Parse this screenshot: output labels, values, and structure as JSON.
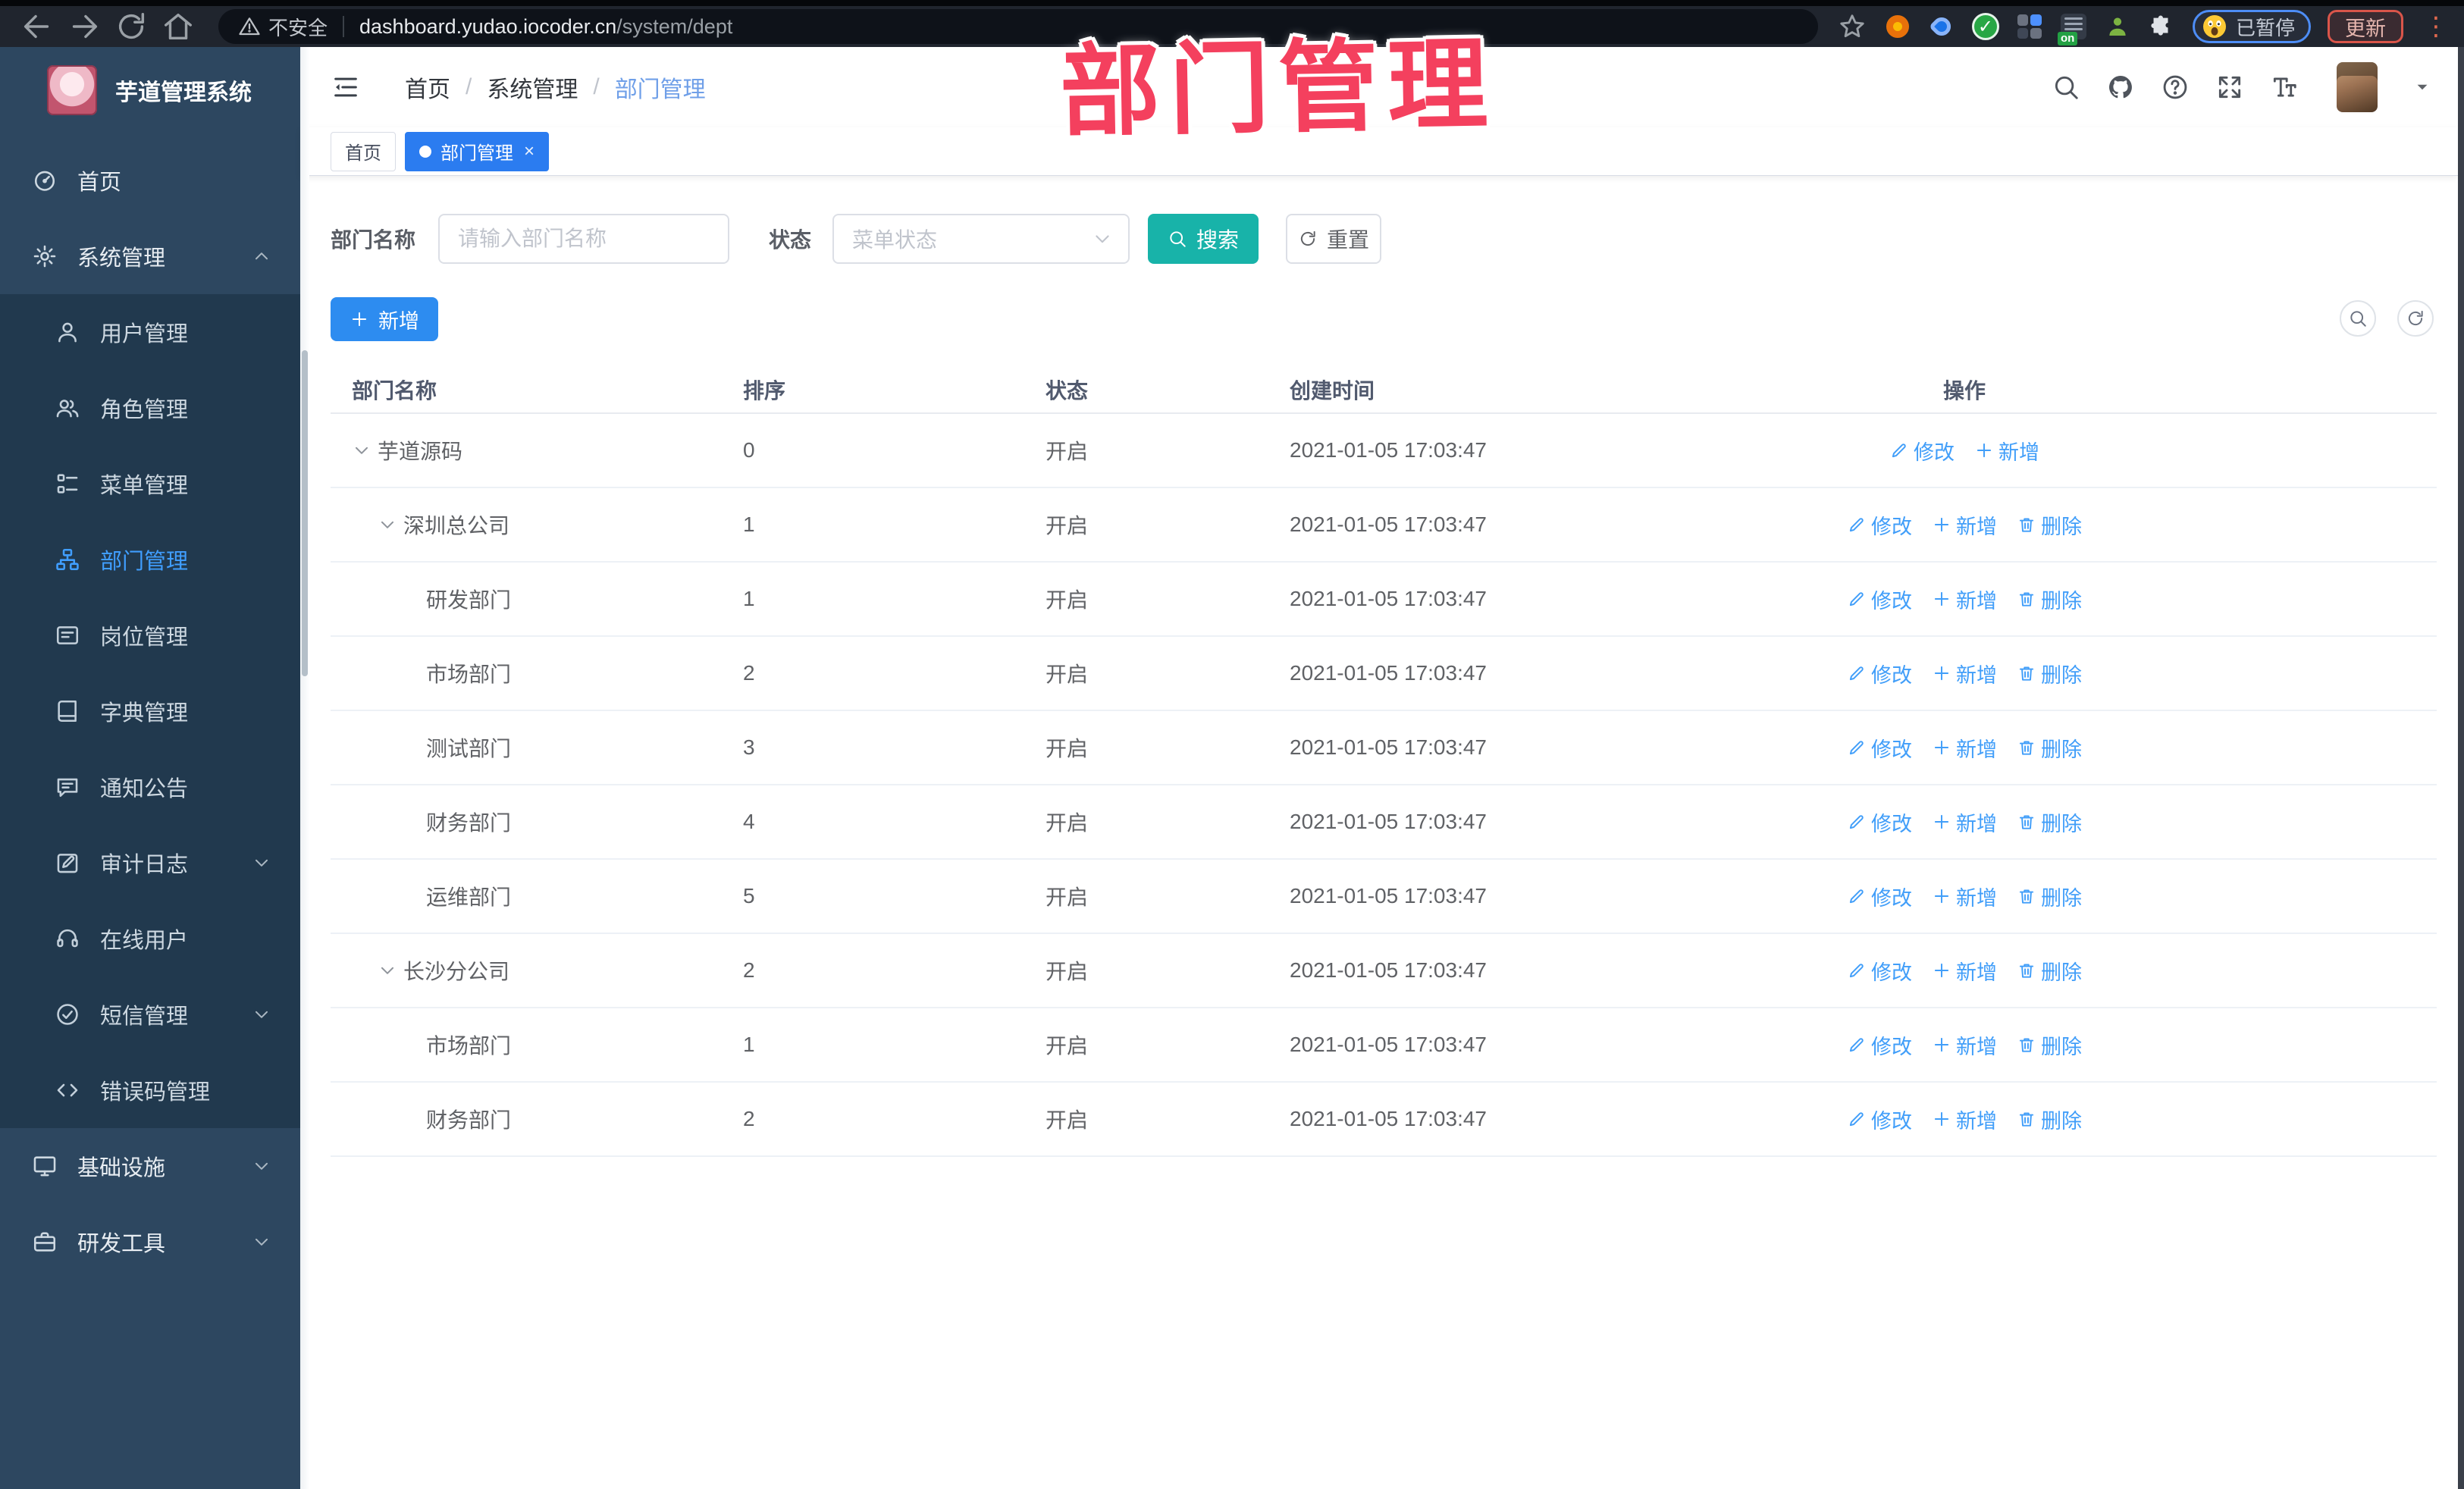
{
  "browser": {
    "security_label": "不安全",
    "url_host": "dashboard.yudao.iocoder.cn",
    "url_path": "/system/dept",
    "paused_label": "已暂停",
    "update_label": "更新",
    "extension_icons": [
      "orange-gear-extension-icon",
      "blue-pin-extension-icon",
      "green-check-extension-icon",
      "grid-extension-icon",
      "list-on-extension-icon",
      "green-person-extension-icon",
      "puzzle-extension-icon"
    ]
  },
  "overlay": {
    "title": "部门管理"
  },
  "sidebar": {
    "title": "芋道管理系统",
    "items": [
      {
        "icon": "dashboard-icon",
        "label": "首页",
        "type": "root"
      },
      {
        "icon": "gear-icon",
        "label": "系统管理",
        "type": "root",
        "chevron": "up"
      },
      {
        "icon": "user-icon",
        "label": "用户管理",
        "type": "sub"
      },
      {
        "icon": "users-icon",
        "label": "角色管理",
        "type": "sub"
      },
      {
        "icon": "tree-menu-icon",
        "label": "菜单管理",
        "type": "sub"
      },
      {
        "icon": "org-icon",
        "label": "部门管理",
        "type": "sub",
        "active": true
      },
      {
        "icon": "idcard-icon",
        "label": "岗位管理",
        "type": "sub"
      },
      {
        "icon": "book-icon",
        "label": "字典管理",
        "type": "sub"
      },
      {
        "icon": "comment-icon",
        "label": "通知公告",
        "type": "sub"
      },
      {
        "icon": "edit-icon",
        "label": "审计日志",
        "type": "sub",
        "chevron": "down"
      },
      {
        "icon": "headset-icon",
        "label": "在线用户",
        "type": "sub"
      },
      {
        "icon": "check-circle-icon",
        "label": "短信管理",
        "type": "sub",
        "chevron": "down"
      },
      {
        "icon": "code-icon",
        "label": "错误码管理",
        "type": "sub"
      },
      {
        "icon": "monitor-icon",
        "label": "基础设施",
        "type": "root",
        "chevron": "down"
      },
      {
        "icon": "toolbox-icon",
        "label": "研发工具",
        "type": "root",
        "chevron": "down"
      }
    ]
  },
  "breadcrumb": {
    "items": [
      "首页",
      "系统管理",
      "部门管理"
    ]
  },
  "header_icons": [
    "search-icon",
    "github-icon",
    "question-icon",
    "fullscreen-icon",
    "font-size-icon"
  ],
  "tags": {
    "items": [
      {
        "label": "首页",
        "active": false,
        "closable": false
      },
      {
        "label": "部门管理",
        "active": true,
        "closable": true
      }
    ]
  },
  "filter": {
    "name_label": "部门名称",
    "name_placeholder": "请输入部门名称",
    "status_label": "状态",
    "status_placeholder": "菜单状态",
    "search_label": "搜索",
    "reset_label": "重置"
  },
  "toolbar": {
    "add_label": "新增"
  },
  "table": {
    "headers": [
      "部门名称",
      "排序",
      "状态",
      "创建时间",
      "操作"
    ],
    "action_labels": {
      "edit": "修改",
      "add": "新增",
      "delete": "删除"
    },
    "rows": [
      {
        "name": "芋道源码",
        "level": 0,
        "caret": true,
        "order": "0",
        "status": "开启",
        "created": "2021-01-05 17:03:47",
        "actions": [
          "edit",
          "add"
        ]
      },
      {
        "name": "深圳总公司",
        "level": 1,
        "caret": true,
        "order": "1",
        "status": "开启",
        "created": "2021-01-05 17:03:47",
        "actions": [
          "edit",
          "add",
          "delete"
        ]
      },
      {
        "name": "研发部门",
        "level": 2,
        "caret": false,
        "order": "1",
        "status": "开启",
        "created": "2021-01-05 17:03:47",
        "actions": [
          "edit",
          "add",
          "delete"
        ]
      },
      {
        "name": "市场部门",
        "level": 2,
        "caret": false,
        "order": "2",
        "status": "开启",
        "created": "2021-01-05 17:03:47",
        "actions": [
          "edit",
          "add",
          "delete"
        ]
      },
      {
        "name": "测试部门",
        "level": 2,
        "caret": false,
        "order": "3",
        "status": "开启",
        "created": "2021-01-05 17:03:47",
        "actions": [
          "edit",
          "add",
          "delete"
        ]
      },
      {
        "name": "财务部门",
        "level": 2,
        "caret": false,
        "order": "4",
        "status": "开启",
        "created": "2021-01-05 17:03:47",
        "actions": [
          "edit",
          "add",
          "delete"
        ]
      },
      {
        "name": "运维部门",
        "level": 2,
        "caret": false,
        "order": "5",
        "status": "开启",
        "created": "2021-01-05 17:03:47",
        "actions": [
          "edit",
          "add",
          "delete"
        ]
      },
      {
        "name": "长沙分公司",
        "level": 1,
        "caret": true,
        "order": "2",
        "status": "开启",
        "created": "2021-01-05 17:03:47",
        "actions": [
          "edit",
          "add",
          "delete"
        ]
      },
      {
        "name": "市场部门",
        "level": 2,
        "caret": false,
        "order": "1",
        "status": "开启",
        "created": "2021-01-05 17:03:47",
        "actions": [
          "edit",
          "add",
          "delete"
        ]
      },
      {
        "name": "财务部门",
        "level": 2,
        "caret": false,
        "order": "2",
        "status": "开启",
        "created": "2021-01-05 17:03:47",
        "actions": [
          "edit",
          "add",
          "delete"
        ]
      }
    ]
  },
  "colors": {
    "accent_blue": "#2d8cf0",
    "link_blue": "#419ef9",
    "search_teal": "#18b3a9",
    "overlay_pink": "#f4405e",
    "tag_blue": "#2b7cf0",
    "sidebar_bg": "#2d4760",
    "sidebar_submenu_bg": "#21394e",
    "active_menu_blue": "#409eff"
  }
}
